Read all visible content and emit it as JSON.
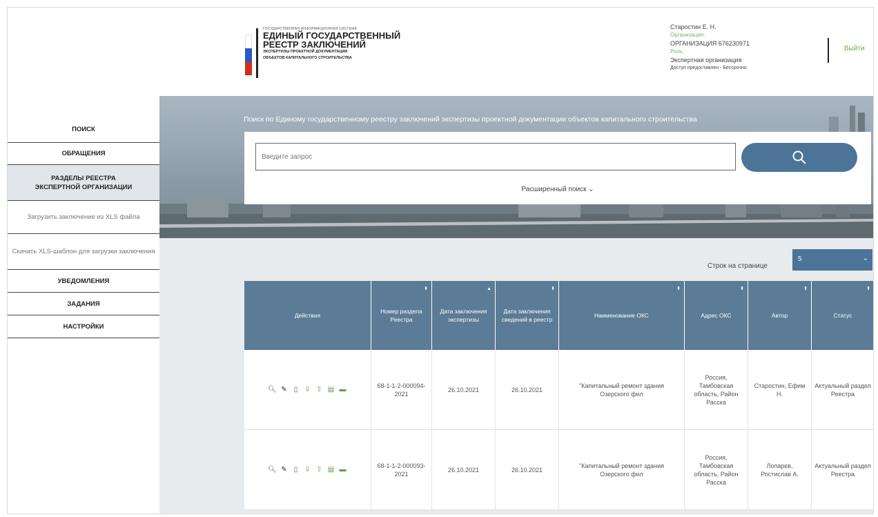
{
  "header": {
    "logo_small": "ГОСУДАРСТВЕННАЯ ИНФОРМАЦИОННАЯ СИСТЕМА",
    "logo_line1": "ЕДИНЫЙ ГОСУДАРСТВЕННЫЙ",
    "logo_line2": "РЕЕСТР ЗАКЛЮЧЕНИЙ",
    "logo_line3": "ЭКСПЕРТИЗЫ ПРОЕКТНОЙ ДОКУМЕНТАЦИИ",
    "logo_line4": "ОБЪЕКТОВ КАПИТАЛЬНОГО СТРОИТЕЛЬСТВА",
    "flag_colors": [
      "#ffffff",
      "#2b59c3",
      "#d52b1e"
    ],
    "user_name": "Старостин Е. Н.",
    "org_label": "Организация:",
    "org_value": "ОРГАНИЗАЦИЯ 676230971",
    "role_label": "Роль:",
    "role_value": "Экспертная организация",
    "access": "Доступ предоставлен - Бессрочно",
    "logout": "Выйти"
  },
  "sidebar": {
    "search": "ПОИСК",
    "appeals": "ОБРАЩЕНИЯ",
    "registry_sections": "РАЗДЕЛЫ РЕЕСТРА ЭКСПЕРТНОЙ ОРГАНИЗАЦИИ",
    "upload_xls": "Загрузить заключение из XLS файла",
    "download_template": "Скачать XLS-шаблон для загрузки заключения",
    "notifications": "УВЕДОМЛЕНИЯ",
    "tasks": "ЗАДАНИЯ",
    "settings": "НАСТРОЙКИ"
  },
  "banner": {
    "caption": "Поиск по Единому государственному реестру заключений экспертизы проектной документации объектов капитального строительства"
  },
  "search": {
    "placeholder": "Введите запрос",
    "advanced": "Расширенный поиск ⌄"
  },
  "pagination": {
    "rows_label": "Строк на странице",
    "rows_value": "5"
  },
  "table": {
    "headers": {
      "actions": "Действия",
      "number": "Номер раздела Реестра",
      "date_conclusion": "Дата заключения экспертизы",
      "date_entry": "Дата заключения сведений в реестр",
      "name": "Наименование ОКС",
      "address": "Адрес ОКС",
      "author": "Автор",
      "status": "Статус"
    },
    "rows": [
      {
        "number": "68-1-1-2-000094-2021",
        "date_conclusion": "26.10.2021",
        "date_entry": "26.10.2021",
        "name": "\"Капитальный ремонт здания Озерского фил",
        "address": "Россия, Тамбовская область, Район Расска",
        "author": "Старостин, Ефим Н.",
        "status": "Актуальный раздел Реестра"
      },
      {
        "number": "68-1-1-2-000093-2021",
        "date_conclusion": "26.10.2021",
        "date_entry": "26.10.2021",
        "name": "\"Капитальный ремонт здания Озерского фил",
        "address": "Россия, Тамбовская область, Район Расска",
        "author": "Лопарев, Ростислав А.",
        "status": "Актуальный раздел Реестра"
      }
    ]
  },
  "colors": {
    "accent": "#4b7498",
    "table_header": "#5b7b96",
    "green": "#6ab04c"
  }
}
